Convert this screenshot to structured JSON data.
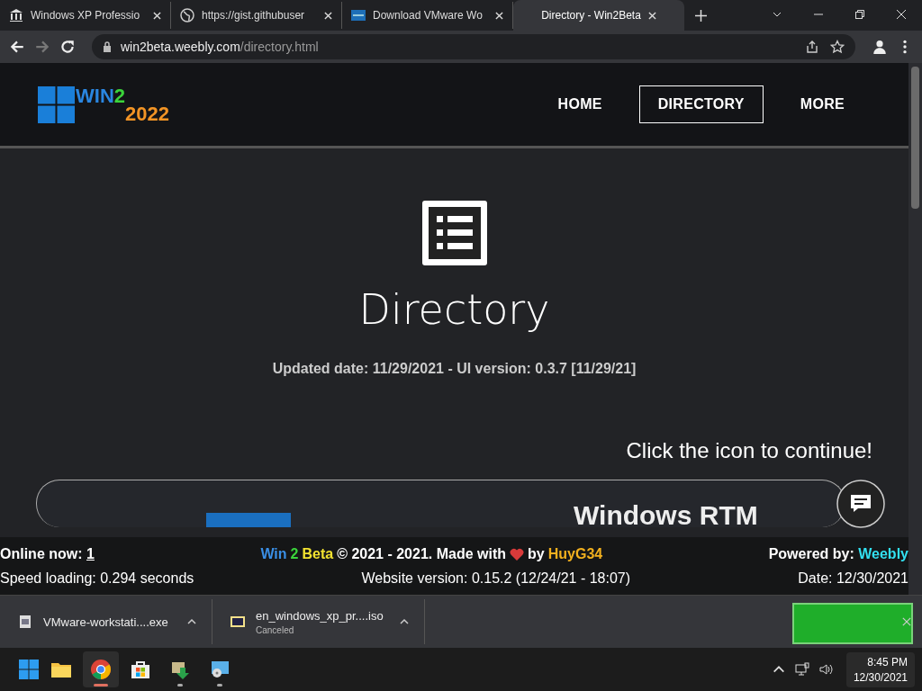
{
  "browser": {
    "tabs": [
      {
        "title": "Windows XP Professio",
        "kind": "library",
        "selected": false
      },
      {
        "title": "https://gist.githubuser",
        "kind": "web",
        "selected": false
      },
      {
        "title": "Download VMware Wo",
        "kind": "app",
        "selected": false
      },
      {
        "title": "Directory - Win2Beta",
        "selected": true
      }
    ],
    "url": {
      "host": "win2beta.weebly.com",
      "path": "/directory.html"
    }
  },
  "site": {
    "logo": {
      "word": "WIN",
      "digit": "2",
      "year": "2022"
    },
    "nav": [
      {
        "label": "HOME",
        "selected": false
      },
      {
        "label": "DIRECTORY",
        "selected": true
      },
      {
        "label": "MORE",
        "selected": false
      }
    ],
    "title": "Directory",
    "updated": "Updated date: 11/29/2021 - UI version: 0.3.7 [11/29/21]",
    "call_to_action": "Click the icon to continue!",
    "card_title": "Windows RTM"
  },
  "footer": {
    "online_label": "Online now:",
    "online_count": "1",
    "brand": [
      "Win",
      "2",
      "Beta"
    ],
    "copyright": "© 2021 - 2021. Made with",
    "by": "by",
    "author": "HuyG34",
    "powered_label": "Powered by:",
    "powered_link": "Weebly",
    "speed": "Speed loading: 0.294 seconds",
    "version": "Website version: 0.15.2 (12/24/21 - 18:07)",
    "date": "Date: 12/30/2021"
  },
  "downloads": [
    {
      "name": "VMware-workstati....exe",
      "kind": "exe"
    },
    {
      "name": "en_windows_xp_pr....iso",
      "kind": "iso",
      "status": "Canceled"
    }
  ],
  "taskbar": {
    "apps": [
      {
        "kind": "explorer",
        "running": false,
        "selected": false
      },
      {
        "kind": "chrome",
        "running": true,
        "selected": true
      },
      {
        "kind": "store",
        "running": false,
        "selected": false
      },
      {
        "kind": "installer",
        "running": true,
        "selected": false
      },
      {
        "kind": "vm",
        "running": true,
        "selected": false
      }
    ],
    "time": "8:45 PM",
    "date": "12/30/2021"
  }
}
